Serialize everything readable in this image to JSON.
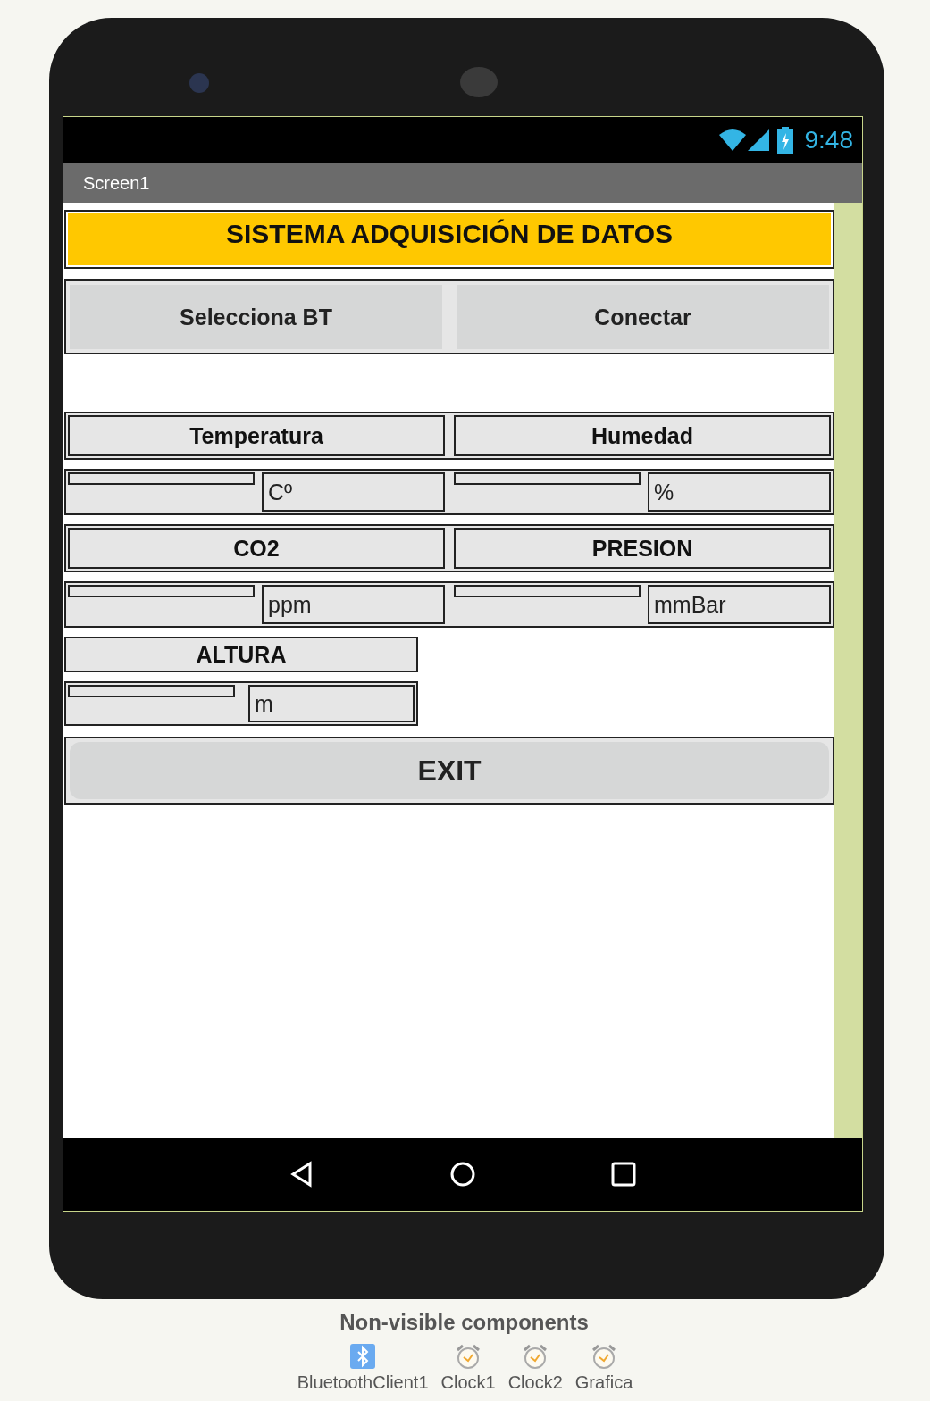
{
  "status_bar": {
    "time": "9:48"
  },
  "title_bar": {
    "title": "Screen1"
  },
  "header": {
    "text": "SISTEMA ADQUISICIÓN DE DATOS"
  },
  "buttons": [
    "Selecciona BT",
    "Conectar"
  ],
  "sensor_rows": [
    {
      "sensors": [
        {
          "label": "Temperatura",
          "unit": "Cº"
        },
        {
          "label": "Humedad",
          "unit": "%"
        }
      ]
    },
    {
      "sensors": [
        {
          "label": "CO2",
          "unit": "ppm"
        },
        {
          "label": "PRESION",
          "unit": "mmBar"
        }
      ]
    }
  ],
  "single_sensor": {
    "label": "ALTURA",
    "unit": "m"
  },
  "exit_button": "EXIT",
  "non_visible": {
    "title": "Non-visible components",
    "components": [
      {
        "name": "BluetoothClient1",
        "kind": "bluetooth"
      },
      {
        "name": "Clock1",
        "kind": "clock"
      },
      {
        "name": "Clock2",
        "kind": "clock"
      },
      {
        "name": "Grafica",
        "kind": "clock"
      }
    ]
  }
}
